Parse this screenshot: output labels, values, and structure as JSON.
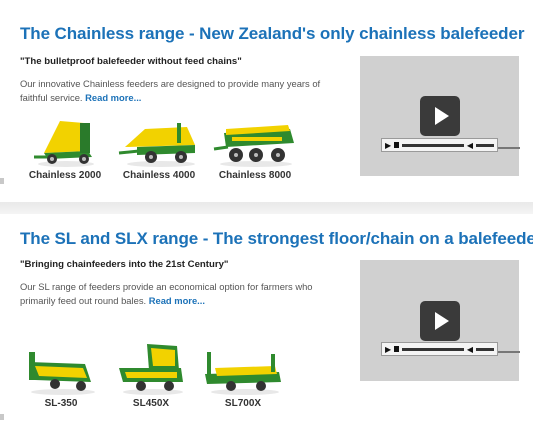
{
  "section1": {
    "title": "The Chainless range - New Zealand's only chainless balefeeder",
    "quote": "\"The bulletproof balefeeder without feed chains\"",
    "desc": "Our innovative Chainless feeders are designed to provide many years of faithful service.",
    "read_more": "Read more...",
    "products": [
      {
        "label": "Chainless 2000"
      },
      {
        "label": "Chainless 4000"
      },
      {
        "label": "Chainless 8000"
      }
    ]
  },
  "section2": {
    "title": "The SL and SLX range - The strongest floor/chain on a balefeeder",
    "quote": "\"Bringing chainfeeders into the 21st Century\"",
    "desc": "Our SL range of feeders provide an economical option for farmers who primarily feed out round bales.",
    "read_more": "Read more...",
    "products": [
      {
        "label": "SL-350"
      },
      {
        "label": "SL450X"
      },
      {
        "label": "SL700X"
      }
    ]
  },
  "colors": {
    "heading": "#1c72b8",
    "machine_green": "#2f8a2e",
    "machine_yellow": "#f2d200"
  },
  "video_player": {
    "play_icon": "play-icon"
  }
}
